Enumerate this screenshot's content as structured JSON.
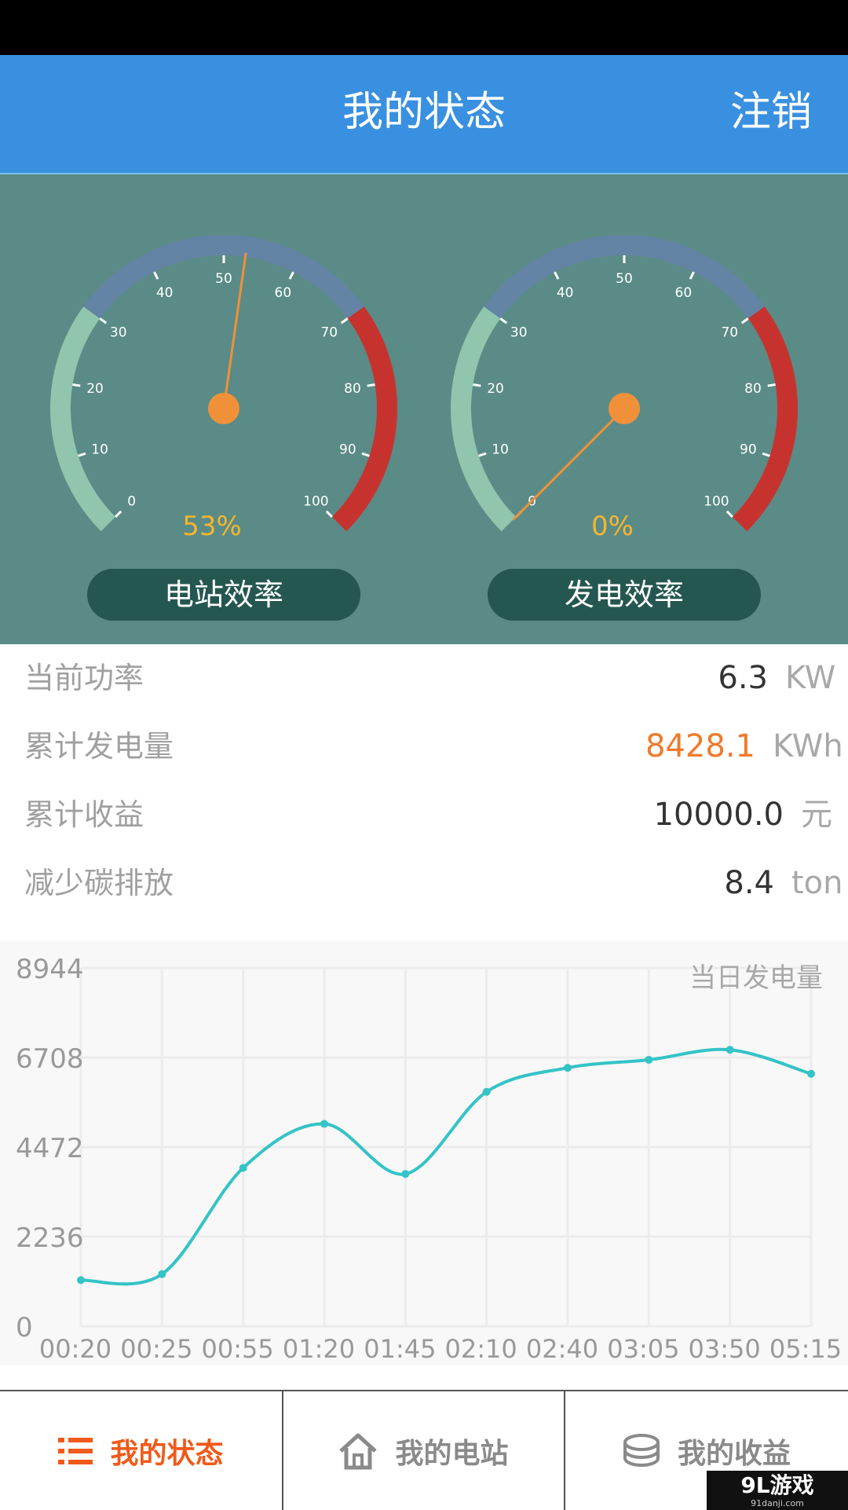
{
  "header": {
    "title": "我的状态",
    "logout_label": "注销"
  },
  "gauges": [
    {
      "label": "电站效率",
      "value": 53,
      "display": "53%",
      "ticks": [
        "0",
        "10",
        "20",
        "30",
        "40",
        "50",
        "60",
        "70",
        "80",
        "90",
        "100"
      ]
    },
    {
      "label": "发电效率",
      "value": 0,
      "display": "0%",
      "ticks": [
        "0",
        "10",
        "20",
        "30",
        "40",
        "50",
        "60",
        "70",
        "80",
        "90",
        "100"
      ]
    }
  ],
  "gauge_colors": {
    "low": "#8fc6ad",
    "mid": "#6384a5",
    "high": "#c6332f",
    "needle": "#f0913a"
  },
  "stats": [
    {
      "label": "当前功率",
      "value": "6.3",
      "unit": "KW",
      "highlight": false
    },
    {
      "label": "累计发电量",
      "value": "8428.1",
      "unit": "KWh",
      "highlight": true
    },
    {
      "label": "累计收益",
      "value": "10000.0",
      "unit": "元",
      "highlight": false
    },
    {
      "label": "减少碳排放",
      "value": "8.4",
      "unit": "ton",
      "highlight": false
    }
  ],
  "chart_data": {
    "type": "line",
    "title": "当日发电量",
    "x": [
      "00:20",
      "00:25",
      "00:55",
      "01:20",
      "01:45",
      "02:10",
      "02:40",
      "03:05",
      "03:50",
      "05:15"
    ],
    "values": [
      1150,
      1300,
      3950,
      5050,
      3800,
      5850,
      6450,
      6650,
      6900,
      6300
    ],
    "yticks": [
      0,
      2236,
      4472,
      6708,
      8944
    ],
    "ylim": [
      0,
      8944
    ],
    "color": "#34c3c6"
  },
  "tabs": [
    {
      "label": "我的状态",
      "icon": "list-icon",
      "active": true
    },
    {
      "label": "我的电站",
      "icon": "home-icon",
      "active": false
    },
    {
      "label": "我的收益",
      "icon": "coins-icon",
      "active": false
    }
  ],
  "watermark": {
    "text": "9L游戏",
    "sub": "91danji.com"
  }
}
